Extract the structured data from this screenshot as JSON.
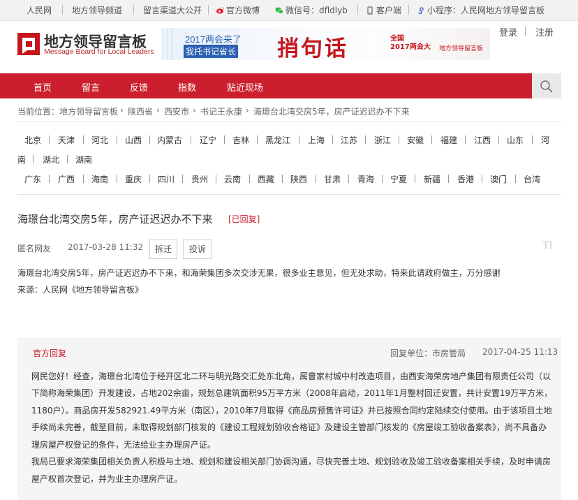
{
  "topbar": {
    "items": [
      "人民网",
      "地方领导频道",
      "留言渠道大公开",
      "官方微博",
      "微信号：dfldlyb",
      "客户端",
      "小程序：人民网地方领导留言板"
    ]
  },
  "header": {
    "logo_title": "地方领导留言板",
    "logo_subtitle": "Message Board for Local Leaders",
    "banner": {
      "line1": "2017两会来了",
      "line2": "我托书记省长",
      "headline": "捎句话",
      "tag1": "全国",
      "tag2": "2017两会大",
      "tag3": "地方领导留言板"
    },
    "login": "登录",
    "register": "注册"
  },
  "nav": {
    "items": [
      "首页",
      "留言",
      "反馈",
      "指数",
      "贴近现场"
    ]
  },
  "breadcrumb": {
    "items": [
      "当前位置：地方领导留言板",
      "陕西省",
      "西安市",
      "书记王永康",
      "海璟台北湾交房5年，房产证迟迟办不下来"
    ],
    "sep": "›"
  },
  "regions": {
    "row1": [
      "北京",
      "天津",
      "河北",
      "山西",
      "内蒙古",
      "辽宁",
      "吉林",
      "黑龙江",
      "上海",
      "江苏",
      "浙江",
      "安徽",
      "福建",
      "江西",
      "山东",
      "河"
    ],
    "row2": [
      "南",
      "湖北",
      "湖南"
    ],
    "row3": [
      "广东",
      "广西",
      "海南",
      "重庆",
      "四川",
      "贵州",
      "云南",
      "西藏",
      "陕西",
      "甘肃",
      "青海",
      "宁夏",
      "新疆",
      "香港",
      "澳门",
      "台湾"
    ]
  },
  "article": {
    "title": "海璟台北湾交房5年，房产证迟迟办不下来",
    "status": "[已回复]",
    "author": "匿名网友",
    "datetime": "2017-03-28 11:32",
    "tags": [
      "拆迁",
      "投诉"
    ],
    "watermark": "Tl",
    "body": "海璟台北湾交房5年，房产证迟迟办不下来，和海荣集团多次交涉无果，很多业主意见，但无处求助，特来此请政府做主，万分感谢",
    "source": "来源：人民网《地方领导留言板》"
  },
  "reply": {
    "label": "官方回复",
    "unit": "回复单位：市房管局",
    "datetime": "2017-04-25 11:13",
    "lines": [
      "网民您好！经查，海璟台北湾位于经开区北二环与明光路交汇处东北角，属曹家村城中村改造项目，由西安海荣房地产集团有限责任公司（以",
      "下简称海荣集团）开发建设，占地202余亩，规划总建筑面积95万平方米（2008年启动，2011年1月整村回迁安置，共计安置19万平方米，",
      "1180户）。商品房开发582921.49平方米（南区），2010年7月取得《商品房预售许可证》并已按照合同约定陆续交付使用。由于该项目土地",
      "手续尚未完善，截至目前，未取得规划部门核发的《建设工程规划验收合格证》及建设主管部门核发的《房屋竣工验收备案表》，尚不具备办",
      "理房屋产权登记的条件，无法给业主办理房产证。",
      "我局已要求海荣集团相关负责人积极与土地、规划和建设相关部门协调沟通，尽快完善土地、规划验收及竣工验收备案相关手续，及时申请房",
      "屋产权首次登记，并为业主办理房产证。"
    ]
  }
}
